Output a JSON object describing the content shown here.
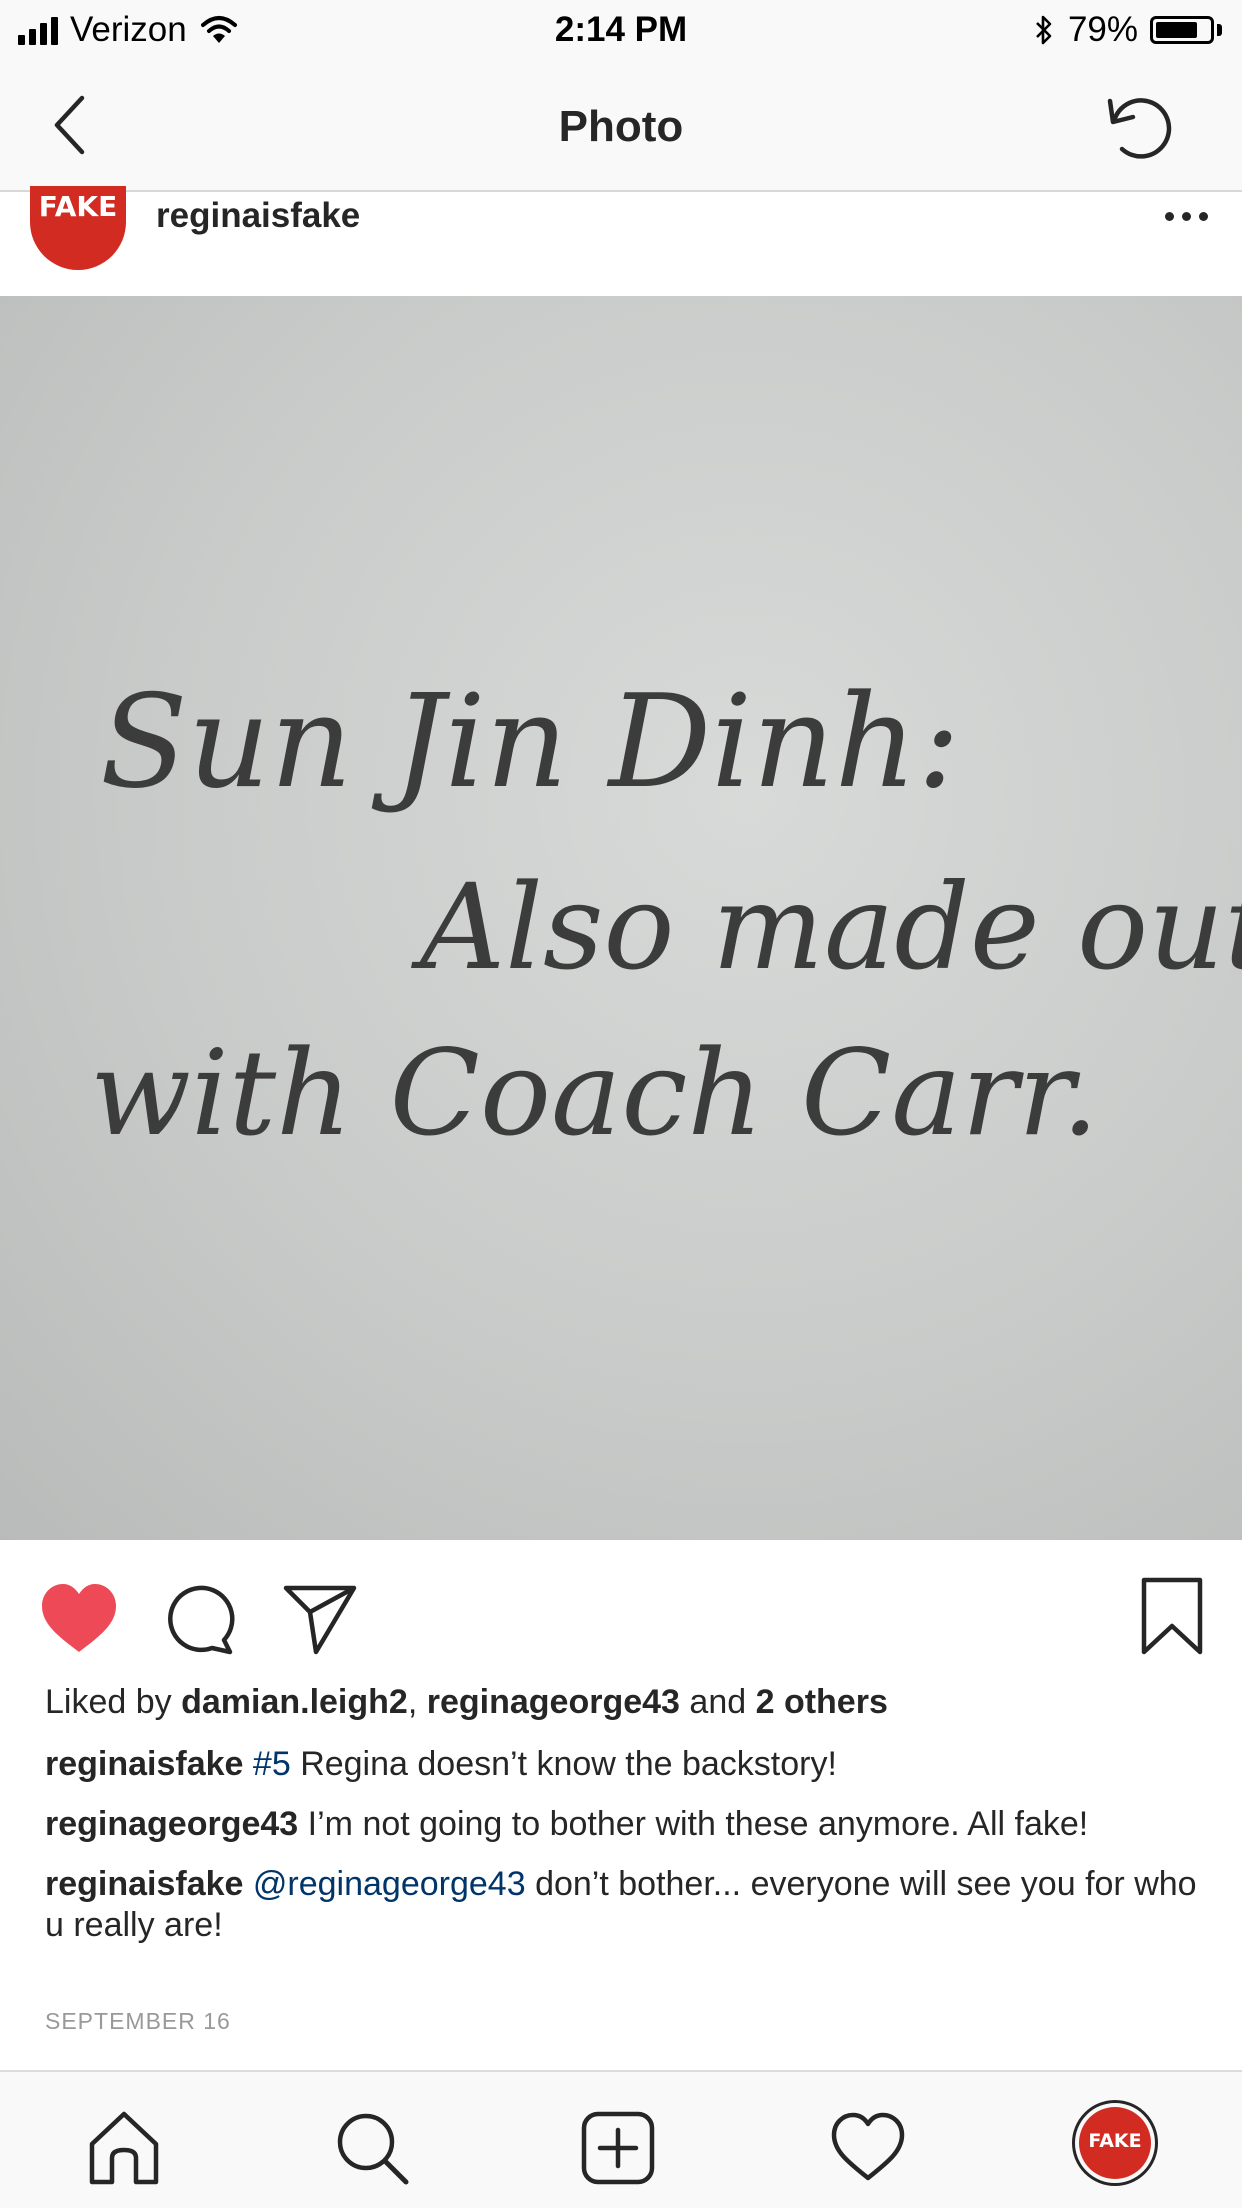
{
  "status_bar": {
    "carrier": "Verizon",
    "time": "2:14 PM",
    "battery_percent": "79%",
    "battery_level": 0.79,
    "icons": [
      "signal-icon",
      "wifi-icon",
      "bluetooth-icon",
      "battery-icon"
    ]
  },
  "nav": {
    "title": "Photo",
    "back_icon": "chevron-left-icon",
    "refresh_icon": "refresh-icon"
  },
  "post": {
    "avatar_text": "FAKE",
    "username": "reginaisfake",
    "more_icon": "ellipsis-icon",
    "photo_text": {
      "line1": "Sun Jin Dinh:",
      "line2": "Also made out",
      "line3": "with Coach Carr."
    },
    "actions": {
      "like_icon": "heart-filled-icon",
      "like_color": "#ed4956",
      "comment_icon": "comment-icon",
      "share_icon": "send-icon",
      "save_icon": "bookmark-icon"
    },
    "likes": {
      "prefix": "Liked by",
      "user1": "damian.leigh2",
      "separator": ",",
      "user2": "reginageorge43",
      "conjunction": "and",
      "others": "2 others"
    },
    "comments": [
      {
        "user": "reginaisfake",
        "tag": "#5",
        "text": "Regina doesn’t know the backstory!"
      },
      {
        "user": "reginageorge43",
        "text": "I’m not going to bother with these anymore. All fake!"
      },
      {
        "user": "reginaisfake",
        "mention": "@reginageorge43",
        "text": "don’t bother... everyone will see you for who u really are!"
      }
    ],
    "date": "SEPTEMBER 16"
  },
  "tab_bar": {
    "icons": [
      "home-icon",
      "search-icon",
      "new-post-icon",
      "activity-heart-icon",
      "profile-avatar"
    ],
    "profile_text": "FAKE"
  },
  "colors": {
    "avatar_red": "#d22c22",
    "link_blue": "#003569",
    "like_red": "#ed4956"
  }
}
